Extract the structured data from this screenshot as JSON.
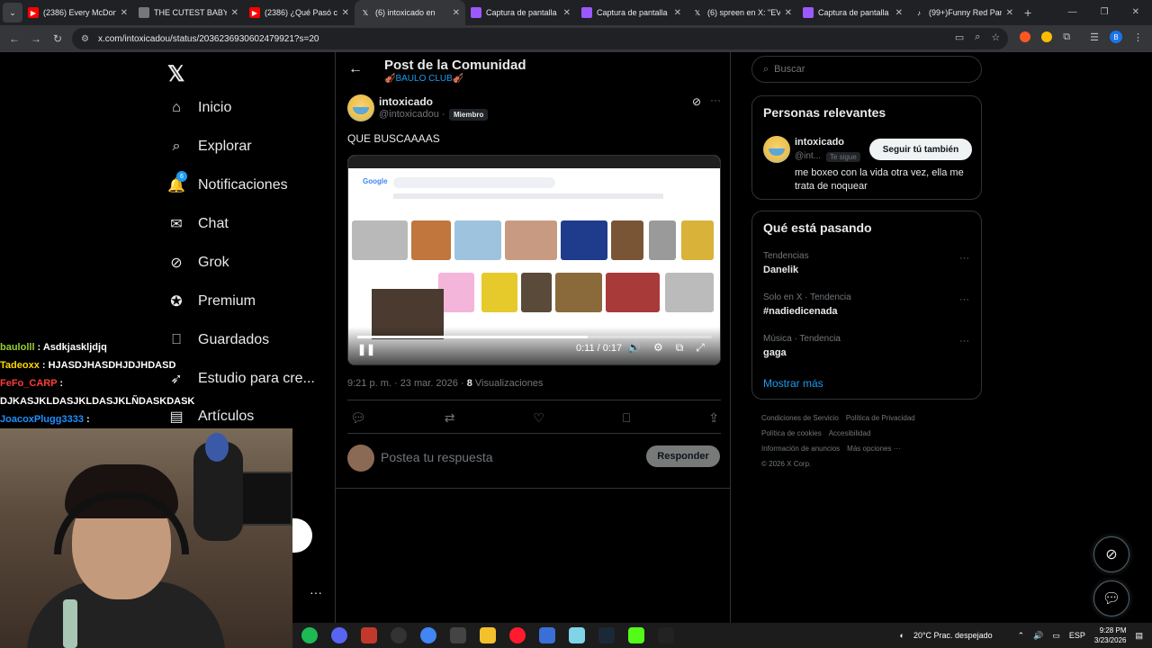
{
  "browser": {
    "tabs": [
      {
        "title": "(2386) Every McDona",
        "icon": "youtube-icon",
        "color": "#ff0000"
      },
      {
        "title": "THE CUTEST BABY AN",
        "icon": "page-icon",
        "color": "#777777"
      },
      {
        "title": "(2386) ¿Qué Pasó con",
        "icon": "youtube-icon",
        "color": "#ff0000"
      },
      {
        "title": "(6) intoxicado en",
        "icon": "x-icon",
        "color": "#ffffff",
        "active": true
      },
      {
        "title": "Captura de pantalla",
        "icon": "pen-icon",
        "color": "#9b59ff"
      },
      {
        "title": "Captura de pantalla",
        "icon": "pen-icon",
        "color": "#9b59ff"
      },
      {
        "title": "(6) spreen en X: \"EVE",
        "icon": "x-icon",
        "color": "#ffffff"
      },
      {
        "title": "Captura de pantalla",
        "icon": "pen-icon",
        "color": "#9b59ff"
      },
      {
        "title": "(99+)Funny Red Pand",
        "icon": "tiktok-icon",
        "color": "#ffffff"
      }
    ],
    "url": "x.com/intoxicadou/status/2036236930602479921?s=20",
    "profile_initial": "B"
  },
  "sidebar": {
    "items": [
      {
        "label": "Inicio",
        "icon": "home-icon",
        "glyph": "⌂"
      },
      {
        "label": "Explorar",
        "icon": "search-icon",
        "glyph": "⌕"
      },
      {
        "label": "Notificaciones",
        "icon": "bell-icon",
        "glyph": "🔔",
        "badge": "6"
      },
      {
        "label": "Chat",
        "icon": "mail-icon",
        "glyph": "✉"
      },
      {
        "label": "Grok",
        "icon": "grok-icon",
        "glyph": "⊘"
      },
      {
        "label": "Premium",
        "icon": "verified-icon",
        "glyph": "✪"
      },
      {
        "label": "Guardados",
        "icon": "bookmark-icon",
        "glyph": "⎕"
      },
      {
        "label": "Estudio para cre...",
        "icon": "rocket-icon",
        "glyph": "➶"
      },
      {
        "label": "Artículos",
        "icon": "article-icon",
        "glyph": "▤"
      }
    ]
  },
  "stream_chat": [
    {
      "user": "baulolll",
      "msg": " : Asdkjaskljdjq",
      "cls": "u1"
    },
    {
      "user": "Tadeoxx",
      "msg": " : HJASDJHASDHJDJHDASD",
      "cls": "u2"
    },
    {
      "user": "FeFo_CARP",
      "msg": " :",
      "cls": "u3"
    },
    {
      "user": "",
      "msg": "DJKASJKLDASJKLDASJKLÑDASKDASK",
      "cls": ""
    },
    {
      "user": "JoacoxPlugg3333",
      "msg": " :",
      "cls": "u4"
    }
  ],
  "post": {
    "header_title": "Post de la Comunidad",
    "community": "🎻BAULO CLUB🎻",
    "author_name": "intoxicado",
    "author_handle": "@intoxicadou ·",
    "member_badge": "Miembro",
    "text": "QUE BUSCAAAAS",
    "video_time": "0:11 / 0:17",
    "video_progress": 0.65,
    "timestamp": "9:21 p. m. · 23 mar. 2026 ·",
    "views_count": "8",
    "views_label": "Visualizaciones",
    "reply_placeholder": "Postea tu respuesta",
    "reply_button": "Responder"
  },
  "right": {
    "search_placeholder": "Buscar",
    "relevant_title": "Personas relevantes",
    "relevant_name": "intoxicado",
    "relevant_handle": "@int...",
    "follows_you": "Te sigue",
    "follow_button": "Seguir tú también",
    "relevant_bio": "me boxeo con la vida otra vez, ella me trata de noquear",
    "trending_title": "Qué está pasando",
    "trends": [
      {
        "category": "Tendencias",
        "name": "Danelik"
      },
      {
        "category": "Solo en X · Tendencia",
        "name": "#nadiedicenada"
      },
      {
        "category": "Música · Tendencia",
        "name": "gaga"
      }
    ],
    "show_more": "Mostrar más",
    "footer": [
      "Condiciones de Servicio",
      "Política de Privacidad",
      "Política de cookies",
      "Accesibilidad",
      "Información de anuncios",
      "Más opciones ···",
      "© 2026 X Corp."
    ]
  },
  "taskbar": {
    "weather": "20°C  Prac. despejado",
    "lang": "ESP",
    "time": "9:28 PM",
    "date": "3/23/2026"
  }
}
